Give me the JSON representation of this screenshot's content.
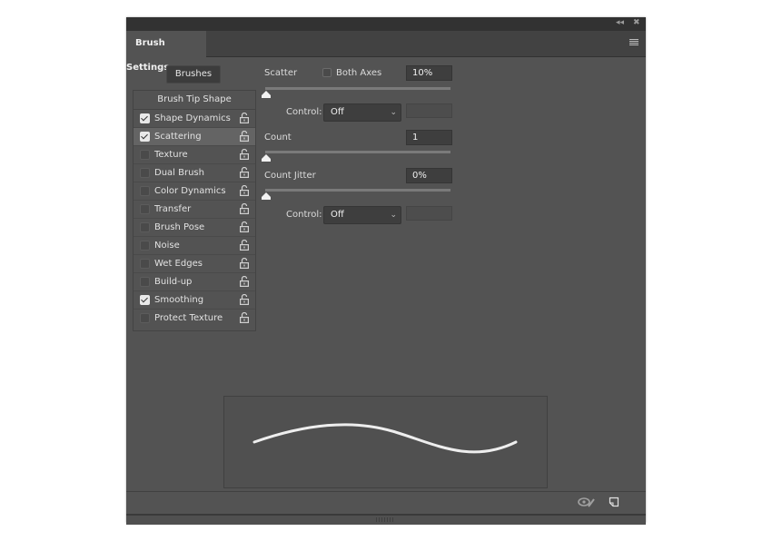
{
  "window": {
    "collapse_icon": "double-chevron-left-icon",
    "close_icon": "close-icon"
  },
  "tab": {
    "title": "Brush Settings",
    "menu_icon": "hamburger-menu-icon"
  },
  "sidebar": {
    "brushes_button": "Brushes",
    "header": "Brush Tip Shape",
    "items": [
      {
        "label": "Shape Dynamics",
        "checked": true,
        "selected": false
      },
      {
        "label": "Scattering",
        "checked": true,
        "selected": true
      },
      {
        "label": "Texture",
        "checked": false,
        "selected": false
      },
      {
        "label": "Dual Brush",
        "checked": false,
        "selected": false
      },
      {
        "label": "Color Dynamics",
        "checked": false,
        "selected": false
      },
      {
        "label": "Transfer",
        "checked": false,
        "selected": false
      },
      {
        "label": "Brush Pose",
        "checked": false,
        "selected": false
      },
      {
        "label": "Noise",
        "checked": false,
        "selected": false
      },
      {
        "label": "Wet Edges",
        "checked": false,
        "selected": false
      },
      {
        "label": "Build-up",
        "checked": false,
        "selected": false
      },
      {
        "label": "Smoothing",
        "checked": true,
        "selected": false
      },
      {
        "label": "Protect Texture",
        "checked": false,
        "selected": false
      }
    ]
  },
  "settings": {
    "scatter": {
      "label": "Scatter",
      "value": "10%",
      "slider_fraction": 0.0,
      "both_axes_label": "Both Axes",
      "both_axes_checked": false,
      "control_label": "Control:",
      "control_value": "Off"
    },
    "count": {
      "label": "Count",
      "value": "1",
      "slider_fraction": 0.0
    },
    "count_jitter": {
      "label": "Count Jitter",
      "value": "0%",
      "slider_fraction": 0.0,
      "control_label": "Control:",
      "control_value": "Off"
    }
  },
  "footer": {
    "toggle_preview_icon": "eye-brush-icon",
    "new_preset_icon": "new-document-icon"
  }
}
